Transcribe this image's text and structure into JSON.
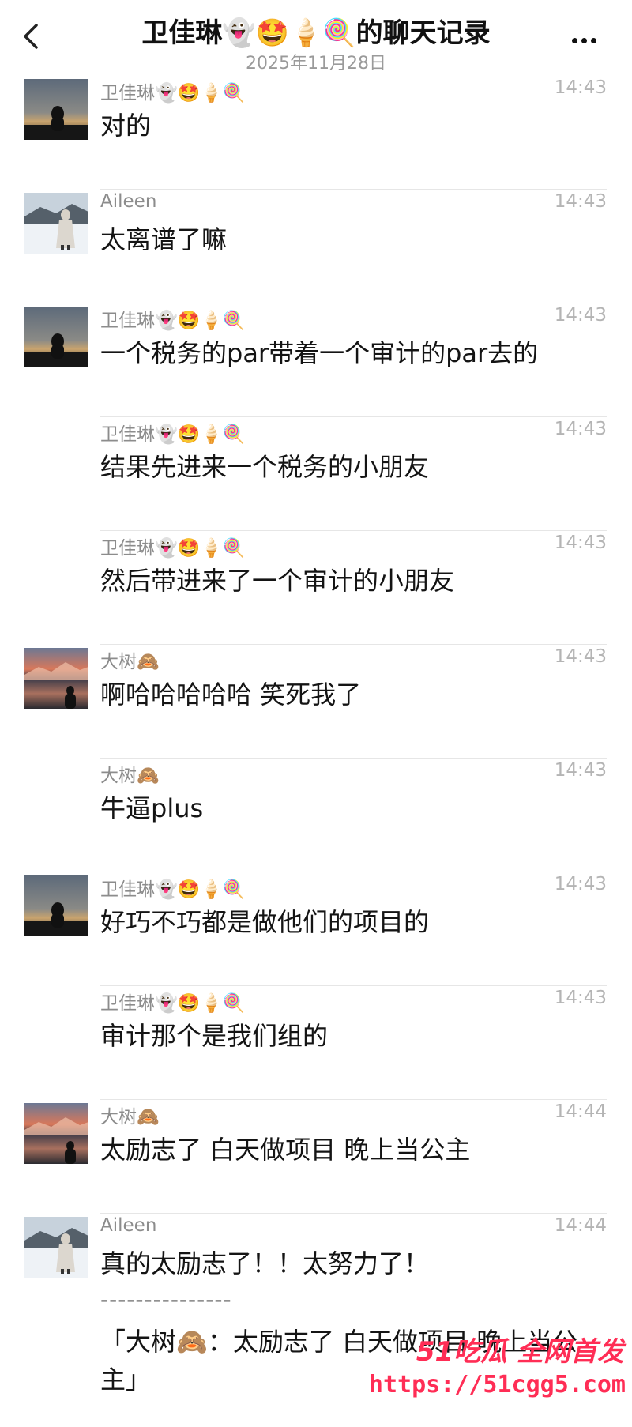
{
  "header": {
    "title": "卫佳琳👻🤩🍦🍭的聊天记录",
    "date": "2025年11月28日"
  },
  "messages": [
    {
      "sender": "卫佳琳👻🤩🍦🍭",
      "time": "14:43",
      "text": "对的",
      "avatar": "dusk"
    },
    {
      "sender": "Aileen",
      "time": "14:43",
      "text": "太离谱了嘛",
      "avatar": "snow"
    },
    {
      "sender": "卫佳琳👻🤩🍦🍭",
      "time": "14:43",
      "text": "一个税务的par带着一个审计的par去的",
      "avatar": "dusk"
    },
    {
      "sender": "卫佳琳👻🤩🍦🍭",
      "time": "14:43",
      "text": "结果先进来一个税务的小朋友",
      "avatar": ""
    },
    {
      "sender": "卫佳琳👻🤩🍦🍭",
      "time": "14:43",
      "text": "然后带进来了一个审计的小朋友",
      "avatar": ""
    },
    {
      "sender": "大树🙈",
      "time": "14:43",
      "text": "啊哈哈哈哈哈 笑死我了",
      "avatar": "sunset"
    },
    {
      "sender": "大树🙈",
      "time": "14:43",
      "text": "牛逼plus",
      "avatar": ""
    },
    {
      "sender": "卫佳琳👻🤩🍦🍭",
      "time": "14:43",
      "text": "好巧不巧都是做他们的项目的",
      "avatar": "dusk"
    },
    {
      "sender": "卫佳琳👻🤩🍦🍭",
      "time": "14:43",
      "text": "审计那个是我们组的",
      "avatar": ""
    },
    {
      "sender": "大树🙈",
      "time": "14:44",
      "text": "太励志了 白天做项目 晚上当公主",
      "avatar": "sunset"
    }
  ],
  "last_message": {
    "sender": "Aileen",
    "time": "14:44",
    "text": "真的太励志了！！太努力了！",
    "separator": "---------------",
    "quote": "「大树🙈：太励志了 白天做项目 晚上当公主」"
  },
  "watermark": {
    "top": "51吃瓜 全网首发",
    "url": "https://51cgg5.com"
  }
}
